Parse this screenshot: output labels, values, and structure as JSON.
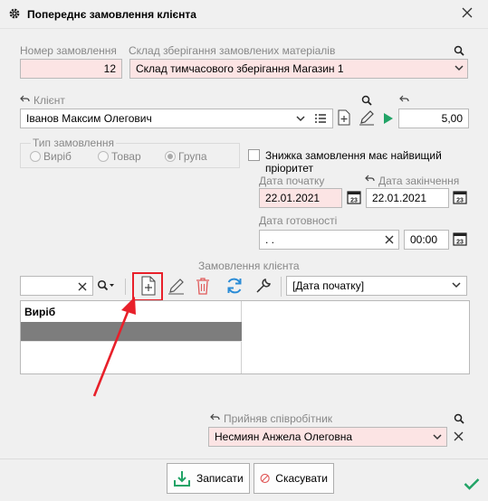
{
  "window": {
    "title": "Попереднє замовлення клієнта",
    "title_icon": "gear-icon",
    "close_icon": "close-icon"
  },
  "order": {
    "number_label": "Номер замовлення",
    "number_value": "12",
    "warehouse_label": "Склад зберігання замовлених матеріалів",
    "warehouse_value": "Склад тимчасового зберігання Магазин 1"
  },
  "client": {
    "label": "Клієнт",
    "value": "Іванов Максим Олегович",
    "amount": "5,00"
  },
  "order_type": {
    "label": "Тип замовлення",
    "options": [
      "Виріб",
      "Товар",
      "Група"
    ],
    "selected": "Група"
  },
  "discount_priority": {
    "label": "Знижка замовлення має найвищий пріоритет",
    "checked": false
  },
  "dates": {
    "start_label": "Дата початку",
    "start_value": "22.01.2021",
    "end_label": "Дата закінчення",
    "end_value": "22.01.2021",
    "ready_label": "Дата готовності",
    "ready_value": " .  .",
    "ready_time": "00:00"
  },
  "client_order": {
    "section_label": "Замовлення клієнта",
    "sort_value": "[Дата початку]",
    "table_header": "Виріб"
  },
  "employee": {
    "label": "Прийняв співробітник",
    "value": "Несмиян Анжела Олеговна"
  },
  "footer": {
    "save_label": "Записати",
    "cancel_label": "Скасувати"
  },
  "colors": {
    "accent_red": "#e8202a",
    "pink_field": "#fce4e4",
    "green": "#21a366",
    "blue": "#2b8cd6"
  }
}
